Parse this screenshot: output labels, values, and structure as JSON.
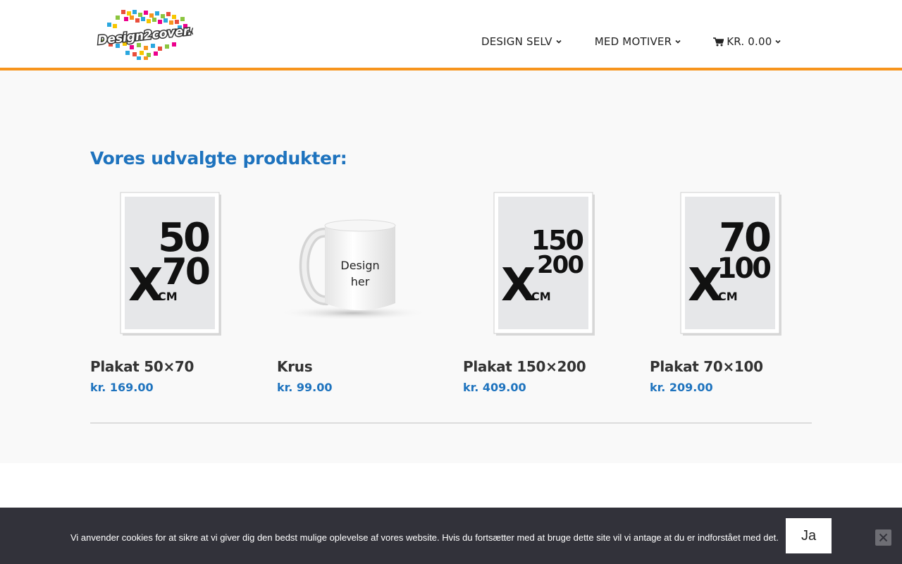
{
  "header": {
    "logo_text": "Design2cover.dk",
    "nav": [
      {
        "label": "DESIGN SELV",
        "icon": "chevron-down-icon"
      },
      {
        "label": "MED MOTIVER",
        "icon": "chevron-down-icon"
      },
      {
        "label": "KR. 0.00",
        "icon": "cart-icon"
      }
    ]
  },
  "main": {
    "section_title": "Vores udvalgte produkter:",
    "products": [
      {
        "name": "Plakat 50×70",
        "price": "kr. 169.00",
        "image_top": "50",
        "image_bottom": "70",
        "image_unit": "CM"
      },
      {
        "name": "Krus",
        "price": "kr. 99.00",
        "image_line1": "Design",
        "image_line2": "her"
      },
      {
        "name": "Plakat 150×200",
        "price": "kr. 409.00",
        "image_top": "150",
        "image_bottom": "200",
        "image_unit": "CM"
      },
      {
        "name": "Plakat 70×100",
        "price": "kr. 209.00",
        "image_top": "70",
        "image_bottom": "100",
        "image_unit": "CM"
      }
    ]
  },
  "cookie": {
    "text": "Vi anvender cookies for at sikre at vi giver dig den bedst mulige oplevelse af vores website. Hvis du fortsætter med at bruge dette site vil vi antage at du er indforstået med det.",
    "accept_label": "Ja",
    "close_icon": "close-icon"
  },
  "colors": {
    "accent_orange": "#f7941d",
    "link_blue": "#1e73be",
    "cookie_bg": "#32323a"
  }
}
